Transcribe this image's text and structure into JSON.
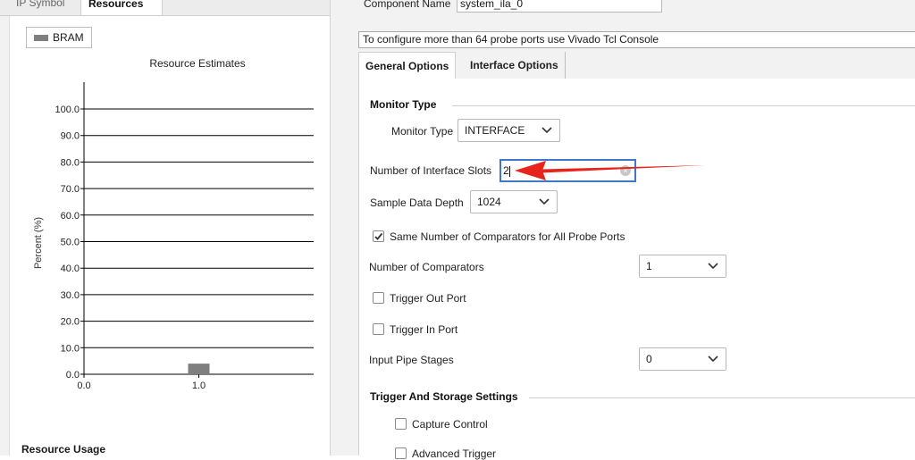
{
  "left_tabs": [
    "IP Symbol",
    "Resources"
  ],
  "legend": {
    "label": "BRAM",
    "color": "#7f7f7f"
  },
  "chart_data": {
    "type": "bar",
    "title": "Resource Estimates",
    "ylabel": "Percent (%)",
    "xlabel": "",
    "x_ticks": [
      "0.0",
      "1.0"
    ],
    "y_ticks": [
      "0.0",
      "10.0",
      "20.0",
      "30.0",
      "40.0",
      "50.0",
      "60.0",
      "70.0",
      "80.0",
      "90.0",
      "100.0"
    ],
    "ylim": [
      0,
      100
    ],
    "xlim": [
      0,
      2
    ],
    "grid": true,
    "series": [
      {
        "name": "BRAM",
        "x": [
          1.0
        ],
        "values": [
          4
        ]
      }
    ]
  },
  "resource_usage_title": "Resource Usage",
  "component": {
    "label": "Component Name",
    "value": "system_ila_0"
  },
  "tcl_note": "To configure more than 64 probe ports use Vivado Tcl Console",
  "option_tabs": [
    "General Options",
    "Interface Options"
  ],
  "monitor": {
    "section_title": "Monitor Type",
    "type_label": "Monitor Type",
    "type_value": "INTERFACE",
    "slots_label": "Number of Interface Slots",
    "slots_value": "2",
    "depth_label": "Sample Data Depth",
    "depth_value": "1024",
    "same_comparators_label": "Same Number of Comparators for All Probe Ports",
    "same_comparators_checked": true,
    "comparators_label": "Number of Comparators",
    "comparators_value": "1",
    "trigger_out_label": "Trigger Out Port",
    "trigger_in_label": "Trigger In Port",
    "pipe_label": "Input Pipe Stages",
    "pipe_value": "0"
  },
  "trigger": {
    "section_title": "Trigger And Storage Settings",
    "capture_label": "Capture Control",
    "advanced_label": "Advanced Trigger"
  },
  "colors": {
    "focus": "#3f78c8",
    "annotation_arrow": "#e8231b",
    "bar": "#7f7f7f"
  },
  "icons": [
    "chevron-down-icon",
    "check-icon",
    "clear-icon",
    "red-arrow-annotation"
  ]
}
